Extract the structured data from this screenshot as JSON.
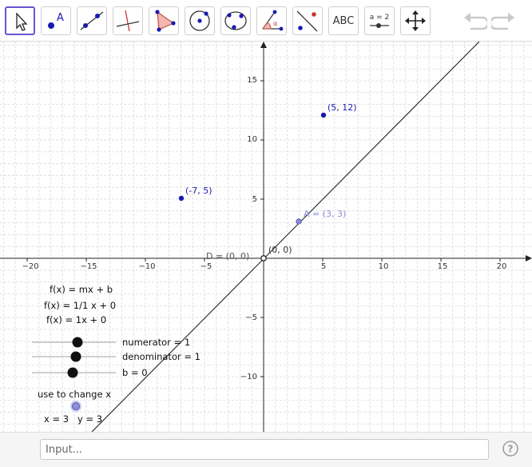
{
  "toolbar": {
    "tools": [
      {
        "name": "move-tool-icon",
        "selected": true
      },
      {
        "name": "point-tool-icon",
        "text": "A"
      },
      {
        "name": "line-tool-icon"
      },
      {
        "name": "perpendicular-line-tool-icon"
      },
      {
        "name": "polygon-tool-icon"
      },
      {
        "name": "circle-center-tool-icon"
      },
      {
        "name": "circle-through-points-tool-icon"
      },
      {
        "name": "angle-tool-icon"
      },
      {
        "name": "reflect-tool-icon"
      },
      {
        "name": "text-tool-icon",
        "text": "ABC"
      },
      {
        "name": "slider-tool-icon",
        "text": "a = 2"
      },
      {
        "name": "move-graphics-tool-icon"
      }
    ],
    "undo_icon": "undo-icon",
    "redo_icon": "redo-icon"
  },
  "graphics": {
    "x_ticks": [
      "−20",
      "−15",
      "−10",
      "−5",
      "5",
      "10",
      "15",
      "20"
    ],
    "y_ticks": [
      "15",
      "10",
      "5",
      "−5",
      "−10"
    ],
    "origin_label": "(0, 0)",
    "point_D_label": "D = (0, 0)",
    "point_A_label": "A = (3, 3)",
    "point_p1_label": "(5, 12)",
    "point_p2_label": "(-7, 5)",
    "function_lines": [
      "f(x) = mx + b",
      "f(x) = 1/1 x + 0",
      "f(x) = 1x + 0"
    ],
    "slider_numerator_label": "numerator = 1",
    "slider_denominator_label": "denominator = 1",
    "slider_b_label": "b = 0",
    "use_text": "use to change x",
    "x_value_text": "x = 3",
    "y_value_text": "y = 3"
  },
  "input": {
    "placeholder": "Input..."
  },
  "help_icon": "help-icon",
  "colors": {
    "point": "#1a1ab0",
    "point_light": "#7f7fd6",
    "grid": "#dcdcdc",
    "axis": "#222222",
    "selected_tool": "#6557d2"
  }
}
